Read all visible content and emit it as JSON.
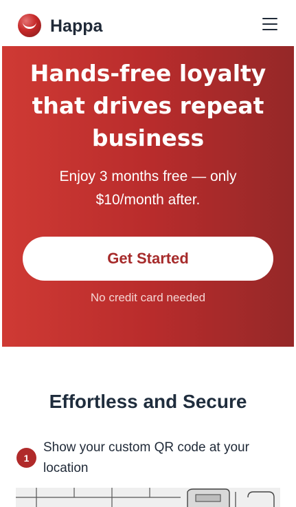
{
  "header": {
    "brand": "Happa",
    "logo_icon": "happa-logo-icon",
    "menu_icon": "hamburger-menu-icon"
  },
  "hero": {
    "title": "Hands-free loyalty that drives repeat business",
    "subtitle": "Enjoy 3 months free — only $10/month after.",
    "cta_label": "Get Started",
    "cta_note": "No credit card needed"
  },
  "section": {
    "title": "Effortless and Secure",
    "steps": [
      {
        "number": "1",
        "text": "Show your custom QR code at your location"
      }
    ]
  },
  "colors": {
    "accent": "#b92c2c",
    "hero_gradient_start": "#cf3a34",
    "hero_gradient_end": "#952828",
    "text_dark": "#1f2d3d"
  }
}
